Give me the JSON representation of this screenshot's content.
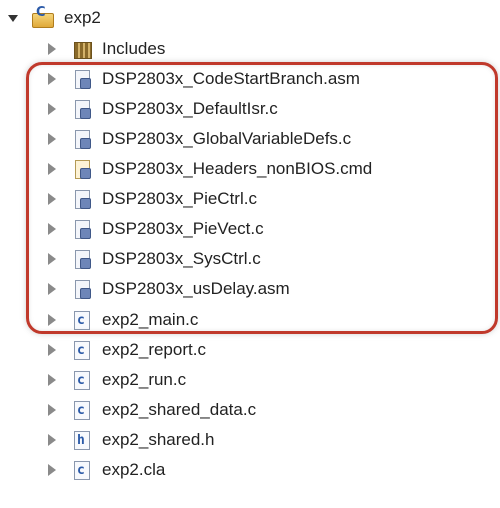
{
  "project": {
    "name": "exp2",
    "expanded": true
  },
  "children": [
    {
      "label": "Includes",
      "icon": "library-folder-icon"
    },
    {
      "label": "DSP2803x_CodeStartBranch.asm",
      "icon": "linked-file-icon"
    },
    {
      "label": "DSP2803x_DefaultIsr.c",
      "icon": "linked-file-icon"
    },
    {
      "label": "DSP2803x_GlobalVariableDefs.c",
      "icon": "linked-file-icon"
    },
    {
      "label": "DSP2803x_Headers_nonBIOS.cmd",
      "icon": "linked-cmd-file-icon"
    },
    {
      "label": "DSP2803x_PieCtrl.c",
      "icon": "linked-file-icon"
    },
    {
      "label": "DSP2803x_PieVect.c",
      "icon": "linked-file-icon"
    },
    {
      "label": "DSP2803x_SysCtrl.c",
      "icon": "linked-file-icon"
    },
    {
      "label": "DSP2803x_usDelay.asm",
      "icon": "linked-file-icon"
    },
    {
      "label": "exp2_main.c",
      "icon": "c-file-icon",
      "glyph": "c"
    },
    {
      "label": "exp2_report.c",
      "icon": "c-file-icon",
      "glyph": "c"
    },
    {
      "label": "exp2_run.c",
      "icon": "c-file-icon",
      "glyph": "c"
    },
    {
      "label": "exp2_shared_data.c",
      "icon": "c-file-icon",
      "glyph": "c"
    },
    {
      "label": "exp2_shared.h",
      "icon": "h-file-icon",
      "glyph": "h"
    },
    {
      "label": "exp2.cla",
      "icon": "c-file-icon",
      "glyph": "c"
    }
  ],
  "colors": {
    "highlight": "#c0392b",
    "text": "#222222"
  }
}
